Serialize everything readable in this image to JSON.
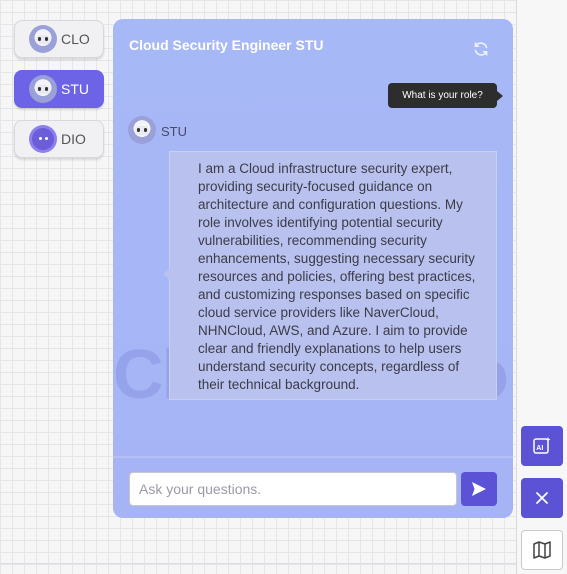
{
  "personas": [
    {
      "label": "CLO",
      "avatar": "robot-avatar",
      "active": false
    },
    {
      "label": "STU",
      "avatar": "robot-avatar",
      "active": true
    },
    {
      "label": "DIO",
      "avatar": "dark-robot-avatar",
      "active": false
    }
  ],
  "chat": {
    "title": "Cloud Security Engineer STU",
    "user_message": "What is your role?",
    "bot_name": "STU",
    "bot_message": "I am a Cloud infrastructure security expert, providing security-focused guidance on architecture and configuration questions. My role involves identifying potential security vulnerabilities, recommending security enhancements, suggesting necessary security resources and policies, offering best practices, and customizing responses based on specific cloud service providers like NaverCloud, NHNCloud, AWS, and Azure. I aim to provide clear and friendly explanations to help users understand security concepts, regardless of their technical background.",
    "watermark": "CloudStudio",
    "input_placeholder": "Ask your questions.",
    "input_value": ""
  },
  "icons": {
    "refresh": "refresh-icon",
    "send": "send-icon",
    "ai_image": "ai-image-icon",
    "close": "close-icon",
    "map": "map-icon"
  },
  "colors": {
    "accent": "#5b52d6",
    "active_tab": "#6d63e6",
    "panel": "#a7b8f7",
    "bubble": "#b9c2ee",
    "tooltip": "#2d2d2d"
  }
}
